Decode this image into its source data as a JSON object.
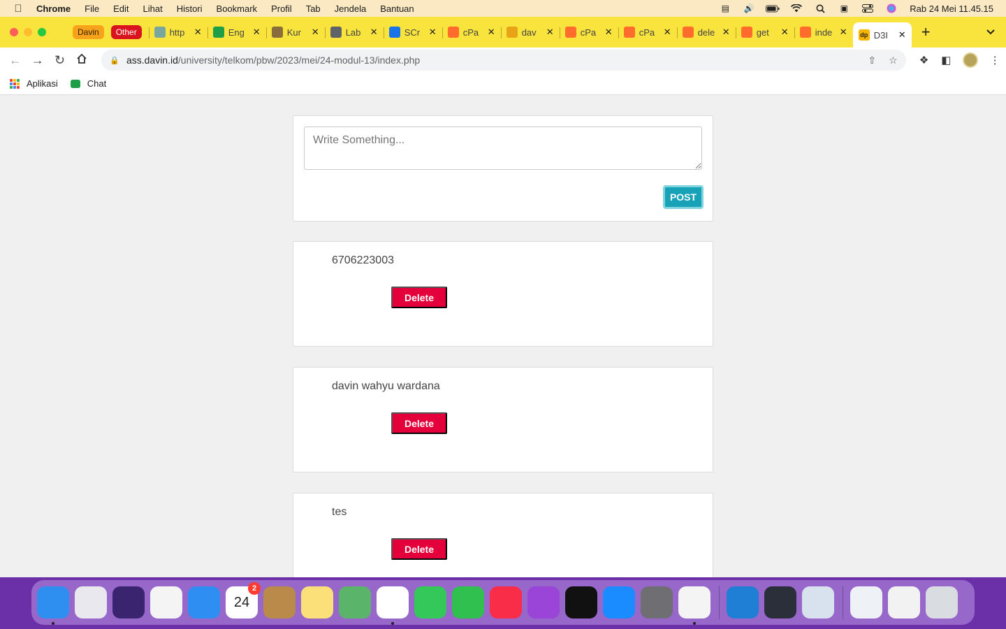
{
  "menubar": {
    "app_name": "Chrome",
    "items": [
      "File",
      "Edit",
      "Lihat",
      "Histori",
      "Bookmark",
      "Profil",
      "Tab",
      "Jendela",
      "Bantuan"
    ],
    "clock": "Rab 24 Mei  11.45.15"
  },
  "tabstrip": {
    "groups": [
      {
        "label": "Davin",
        "color": "#f7a21b"
      },
      {
        "label": "Other",
        "color": "#d9141f"
      }
    ],
    "tabs": [
      {
        "title": "http",
        "fav": "#7aa6a0",
        "icon": "openai-icon"
      },
      {
        "title": "Eng",
        "fav": "#1e9e47",
        "icon": "chat-icon"
      },
      {
        "title": "Kur",
        "fav": "#8a6d3b",
        "icon": "e-icon"
      },
      {
        "title": "Lab",
        "fav": "#5f6368",
        "icon": "globe-icon"
      },
      {
        "title": "SCr",
        "fav": "#1a73e8",
        "icon": "drive-icon"
      },
      {
        "title": "cPa",
        "fav": "#ff6c2c",
        "icon": "cpanel-icon"
      },
      {
        "title": "dav",
        "fav": "#e8a317",
        "icon": "pma-icon"
      },
      {
        "title": "cPa",
        "fav": "#ff6c2c",
        "icon": "cpanel-icon"
      },
      {
        "title": "cPa",
        "fav": "#ff6c2c",
        "icon": "cpanel-icon"
      },
      {
        "title": "dele",
        "fav": "#ff6c2c",
        "icon": "cpanel-icon"
      },
      {
        "title": "get",
        "fav": "#ff6c2c",
        "icon": "cpanel-icon"
      },
      {
        "title": "inde",
        "fav": "#ff6c2c",
        "icon": "cpanel-icon"
      }
    ],
    "active_tab": {
      "title": "D3I",
      "fav": "#f7b500",
      "icon": "site-icon"
    }
  },
  "toolbar": {
    "url_host": "ass.davin.id",
    "url_path": "/university/telkom/pbw/2023/mei/24-modul-13/index.php"
  },
  "bookmarks": {
    "apps_label": "Aplikasi",
    "chat_label": "Chat"
  },
  "page": {
    "composer": {
      "placeholder": "Write Something...",
      "post_label": "POST"
    },
    "posts": [
      {
        "text": "6706223003",
        "delete_label": "Delete"
      },
      {
        "text": "davin wahyu wardana",
        "delete_label": "Delete"
      },
      {
        "text": "tes",
        "delete_label": "Delete"
      }
    ]
  },
  "dock": {
    "apps": [
      {
        "name": "finder",
        "color": "#2f8ff0",
        "running": true
      },
      {
        "name": "launchpad",
        "color": "#e8e8ee",
        "running": false
      },
      {
        "name": "siri",
        "color": "#3a2470",
        "running": false
      },
      {
        "name": "reminders",
        "color": "#f4f4f4",
        "running": false
      },
      {
        "name": "mail",
        "color": "#2e8ef2",
        "running": false
      },
      {
        "name": "calendar",
        "color": "#ffffff",
        "running": false,
        "label": "24",
        "badge": "2"
      },
      {
        "name": "contacts",
        "color": "#b98a4a",
        "running": false
      },
      {
        "name": "notes",
        "color": "#fbe07a",
        "running": false
      },
      {
        "name": "maps",
        "color": "#5ab46a",
        "running": false
      },
      {
        "name": "photos",
        "color": "#ffffff",
        "running": true
      },
      {
        "name": "messages",
        "color": "#34c759",
        "running": false
      },
      {
        "name": "facetime",
        "color": "#30c04f",
        "running": false
      },
      {
        "name": "music",
        "color": "#fa2d48",
        "running": false
      },
      {
        "name": "podcasts",
        "color": "#9b45d8",
        "running": false
      },
      {
        "name": "tv",
        "color": "#111111",
        "running": false
      },
      {
        "name": "app-store",
        "color": "#1a8cff",
        "running": false
      },
      {
        "name": "system-settings",
        "color": "#6e6e73",
        "running": false
      },
      {
        "name": "chrome",
        "color": "#f4f4f4",
        "running": true
      }
    ],
    "apps2": [
      {
        "name": "vscode",
        "color": "#1f7fd4",
        "running": false
      },
      {
        "name": "quicktime",
        "color": "#2a2f3a",
        "running": false
      },
      {
        "name": "preview",
        "color": "#d8e2ee",
        "running": false
      }
    ],
    "apps3": [
      {
        "name": "mp4-file",
        "color": "#eef2f6",
        "running": false
      },
      {
        "name": "screenshot",
        "color": "#f2f2f2",
        "running": false
      },
      {
        "name": "trash",
        "color": "#d9dde2",
        "running": false
      }
    ]
  }
}
